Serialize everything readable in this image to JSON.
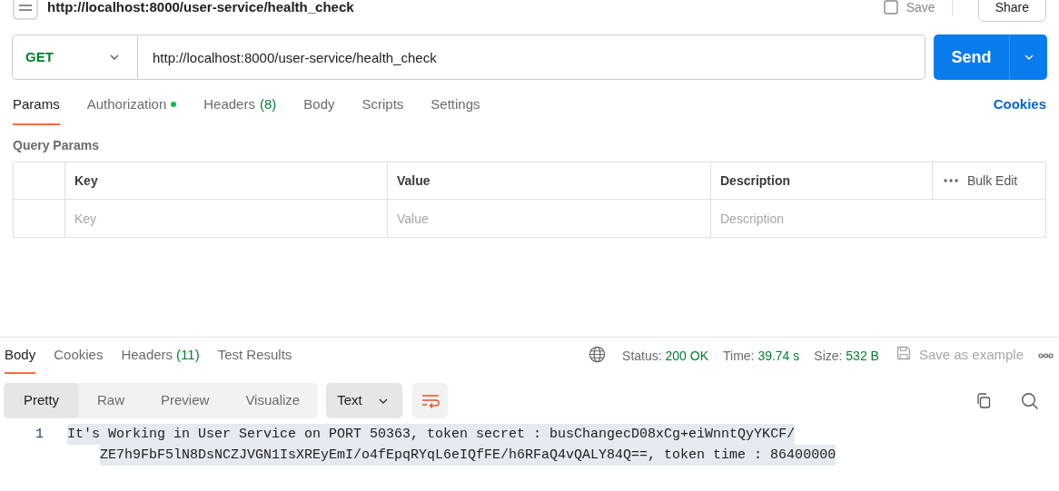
{
  "header": {
    "title": "http://localhost:8000/user-service/health_check",
    "save_label": "Save",
    "share_label": "Share"
  },
  "request": {
    "method": "GET",
    "url": "http://localhost:8000/user-service/health_check",
    "send_label": "Send"
  },
  "request_tabs": [
    {
      "label": "Params",
      "dot": false,
      "selected": true
    },
    {
      "label": "Authorization",
      "dot": true,
      "selected": false
    },
    {
      "label": "Headers",
      "count": "(8)",
      "dot": false,
      "selected": false
    },
    {
      "label": "Body",
      "dot": false,
      "selected": false
    },
    {
      "label": "Scripts",
      "dot": false,
      "selected": false
    },
    {
      "label": "Settings",
      "dot": false,
      "selected": false
    }
  ],
  "cookies_link": "Cookies",
  "query_params": {
    "title": "Query Params",
    "columns": [
      "Key",
      "Value",
      "Description"
    ],
    "bulk_edit": "Bulk Edit",
    "placeholders": [
      "Key",
      "Value",
      "Description"
    ]
  },
  "response_tabs": [
    {
      "label": "Body",
      "selected": true
    },
    {
      "label": "Cookies",
      "selected": false
    },
    {
      "label": "Headers",
      "count": "(11)",
      "selected": false
    },
    {
      "label": "Test Results",
      "selected": false
    }
  ],
  "response_meta": [
    {
      "label": "Status:",
      "value": "200 OK"
    },
    {
      "label": "Time:",
      "value": "39.74 s"
    },
    {
      "label": "Size:",
      "value": "532 B"
    }
  ],
  "save_example": {
    "label": "Save as example",
    "disabled": true
  },
  "view_modes": [
    {
      "label": "Pretty",
      "selected": true
    },
    {
      "label": "Raw",
      "selected": false
    },
    {
      "label": "Preview",
      "selected": false
    },
    {
      "label": "Visualize",
      "selected": false
    }
  ],
  "format": "Text",
  "body_lines": [
    {
      "number": "1",
      "text": [
        "It's Working in User Service on PORT 50363, token secret : busChangecD08xCg+eiWnntQyYKCF/",
        "ZE7h9FbF5lN8DsNCZJVGN1IsXREyEmI/o4fEpqRYqL6eIQfFE/h6RFaQ4vQALY84Q==, token time : 86400000"
      ]
    }
  ]
}
